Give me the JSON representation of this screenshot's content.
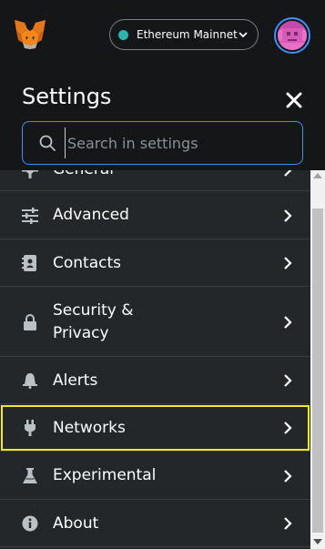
{
  "header": {
    "network": {
      "label": "Ethereum Mainnet",
      "dot_color": "#29b6af"
    },
    "accent_color": "#3e8fff"
  },
  "settings": {
    "title": "Settings",
    "search": {
      "placeholder": "Search in settings",
      "value": ""
    }
  },
  "menu": {
    "partial_item": {
      "label": "General",
      "icon": "gear-icon"
    },
    "items": [
      {
        "label": "Advanced",
        "icon": "sliders-icon"
      },
      {
        "label": "Contacts",
        "icon": "contact-book-icon"
      },
      {
        "label": "Security & Privacy",
        "label_line1": "Security &",
        "label_line2": "Privacy",
        "icon": "lock-icon"
      },
      {
        "label": "Alerts",
        "icon": "bell-icon"
      },
      {
        "label": "Networks",
        "icon": "plug-icon",
        "highlighted": true
      },
      {
        "label": "Experimental",
        "icon": "flask-icon"
      },
      {
        "label": "About",
        "icon": "info-icon"
      }
    ],
    "highlight_color": "#f2ea1a"
  }
}
